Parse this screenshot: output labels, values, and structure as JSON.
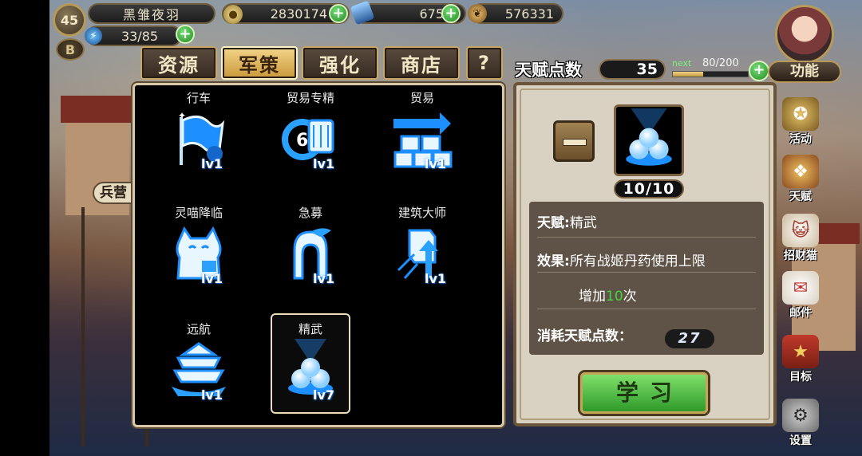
{
  "player": {
    "level": "45",
    "vip": "B",
    "name": "黑雏夜羽",
    "gold": "2830174",
    "gems": "675",
    "leaves": "576331",
    "energy": "33/85"
  },
  "tabs": [
    {
      "label": "资源",
      "active": false
    },
    {
      "label": "军策",
      "active": true
    },
    {
      "label": "强化",
      "active": false
    },
    {
      "label": "商店",
      "active": false
    },
    {
      "label": "?",
      "active": false
    }
  ],
  "talent_points": {
    "label": "天赋点数",
    "value": "35",
    "next_label": "next",
    "next_value": "80/200",
    "next_progress": 0.4
  },
  "talents": [
    {
      "name": "行车",
      "level": "lv1",
      "icon": "flag-icon"
    },
    {
      "name": "贸易专精",
      "level": "lv1",
      "icon": "trade-mastery-icon"
    },
    {
      "name": "贸易",
      "level": "lv1",
      "icon": "trade-crates-icon"
    },
    {
      "name": "灵喵降临",
      "level": "lv1",
      "icon": "lucky-cat-icon"
    },
    {
      "name": "急募",
      "level": "lv1",
      "icon": "helmet-icon"
    },
    {
      "name": "建筑大师",
      "level": "lv1",
      "icon": "building-master-icon"
    },
    {
      "name": "远航",
      "level": "lv1",
      "icon": "ship-icon"
    },
    {
      "name": "精武",
      "level": "lv7",
      "icon": "pearls-icon",
      "selected": true
    }
  ],
  "detail": {
    "count": "10/10",
    "talent_label": "天赋:",
    "talent_name": "精武",
    "effect_label": "效果:",
    "effect_line1": "所有战姬丹药使用上限",
    "effect_line2_prefix": "增加",
    "effect_number": "10",
    "effect_line2_suffix": "次",
    "cost_label": "消耗天赋点数：",
    "cost_value": "27",
    "learn_button": "学习"
  },
  "side_menu": {
    "function_label": "功能",
    "items": [
      {
        "label": "活动",
        "icon": "activity-icon"
      },
      {
        "label": "天赋",
        "icon": "talent-icon"
      },
      {
        "label": "招财猫",
        "icon": "lucky-cat-icon"
      },
      {
        "label": "邮件",
        "icon": "mail-icon"
      },
      {
        "label": "目标",
        "icon": "target-icon"
      },
      {
        "label": "设置",
        "icon": "gear-icon"
      }
    ]
  },
  "barracks_tag": "兵营",
  "colors": {
    "accent_gold": "#c9983a",
    "icon_blue": "#3ab0ff",
    "green_number": "#3fd63f",
    "panel_bg": "#d9d2c2"
  }
}
